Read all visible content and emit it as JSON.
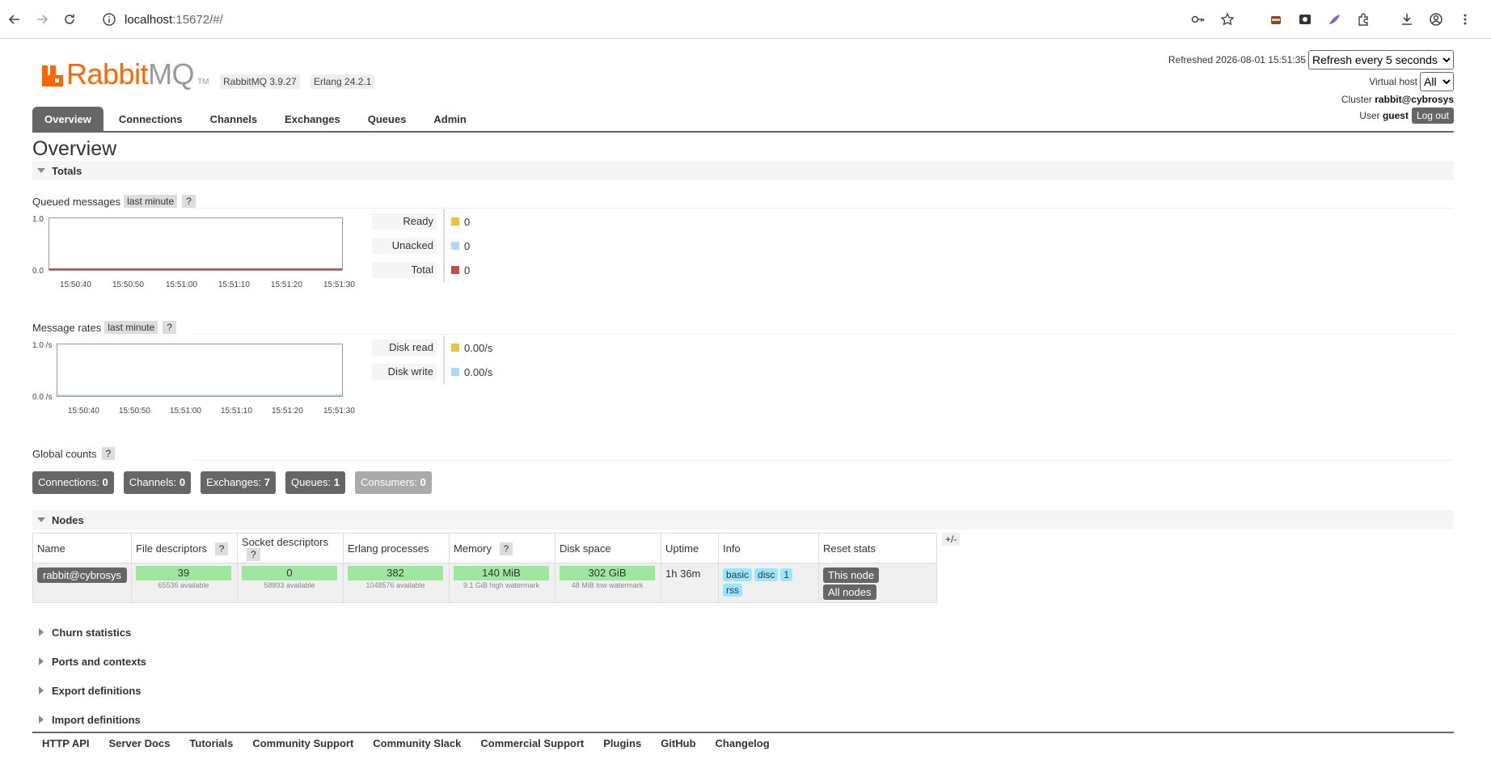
{
  "browser": {
    "url_host": "localhost",
    "url_path": ":15672/#/"
  },
  "app": {
    "logo_brand": "RabbitMQ",
    "logo_tm": "TM",
    "version": "RabbitMQ 3.9.27",
    "erlang": "Erlang 24.2.1",
    "refreshed_label": "Refreshed 2026-08-01 15:51:35",
    "refresh_select": "Refresh every 5 seconds",
    "vhost_label": "Virtual host",
    "vhost_value": "All",
    "cluster_label": "Cluster",
    "cluster_value": "rabbit@cybrosys",
    "user_label": "User",
    "user_value": "guest",
    "logout": "Log out"
  },
  "tabs": [
    "Overview",
    "Connections",
    "Channels",
    "Exchanges",
    "Queues",
    "Admin"
  ],
  "page_title": "Overview",
  "totals": {
    "header": "Totals",
    "queued": {
      "label": "Queued messages",
      "range": "last minute",
      "help": "?",
      "y_top": "1.0",
      "y_bottom": "0.0",
      "x_ticks": [
        "15:50:40",
        "15:50:50",
        "15:51:00",
        "15:51:10",
        "15:51:20",
        "15:51:30"
      ],
      "legend": [
        {
          "label": "Ready",
          "value": "0",
          "color": "#edc240"
        },
        {
          "label": "Unacked",
          "value": "0",
          "color": "#afd8f8"
        },
        {
          "label": "Total",
          "value": "0",
          "color": "#cb4b4b"
        }
      ]
    },
    "rates": {
      "label": "Message rates",
      "range": "last minute",
      "help": "?",
      "y_top": "1.0 /s",
      "y_bottom": "0.0 /s",
      "x_ticks": [
        "15:50:40",
        "15:50:50",
        "15:51:00",
        "15:51:10",
        "15:51:20",
        "15:51:30"
      ],
      "legend": [
        {
          "label": "Disk read",
          "value": "0.00/s",
          "color": "#edc240"
        },
        {
          "label": "Disk write",
          "value": "0.00/s",
          "color": "#afd8f8"
        }
      ]
    },
    "global": {
      "label": "Global counts",
      "help": "?",
      "connections_label": "Connections:",
      "connections": "0",
      "channels_label": "Channels:",
      "channels": "0",
      "exchanges_label": "Exchanges:",
      "exchanges": "7",
      "queues_label": "Queues:",
      "queues": "1",
      "consumers_label": "Consumers:",
      "consumers": "0"
    }
  },
  "nodes": {
    "header": "Nodes",
    "columns": [
      "Name",
      "File descriptors",
      "Socket descriptors",
      "Erlang processes",
      "Memory",
      "Disk space",
      "Uptime",
      "Info",
      "Reset stats"
    ],
    "help": "?",
    "plusminus": "+/-",
    "row": {
      "name": "rabbit@cybrosys",
      "fd": "39",
      "fd_sub": "65536 available",
      "sock": "0",
      "sock_sub": "58893 available",
      "erl": "382",
      "erl_sub": "1048576 available",
      "mem": "140 MiB",
      "mem_sub": "9.1 GiB high watermark",
      "disk": "302 GiB",
      "disk_sub": "48 MiB low watermark",
      "uptime": "1h 36m",
      "info": [
        "basic",
        "disc",
        "1",
        "rss"
      ],
      "reset_this": "This node",
      "reset_all": "All nodes"
    }
  },
  "collapsed_sections": [
    "Churn statistics",
    "Ports and contexts",
    "Export definitions",
    "Import definitions"
  ],
  "footer": [
    "HTTP API",
    "Server Docs",
    "Tutorials",
    "Community Support",
    "Community Slack",
    "Commercial Support",
    "Plugins",
    "GitHub",
    "Changelog"
  ]
}
